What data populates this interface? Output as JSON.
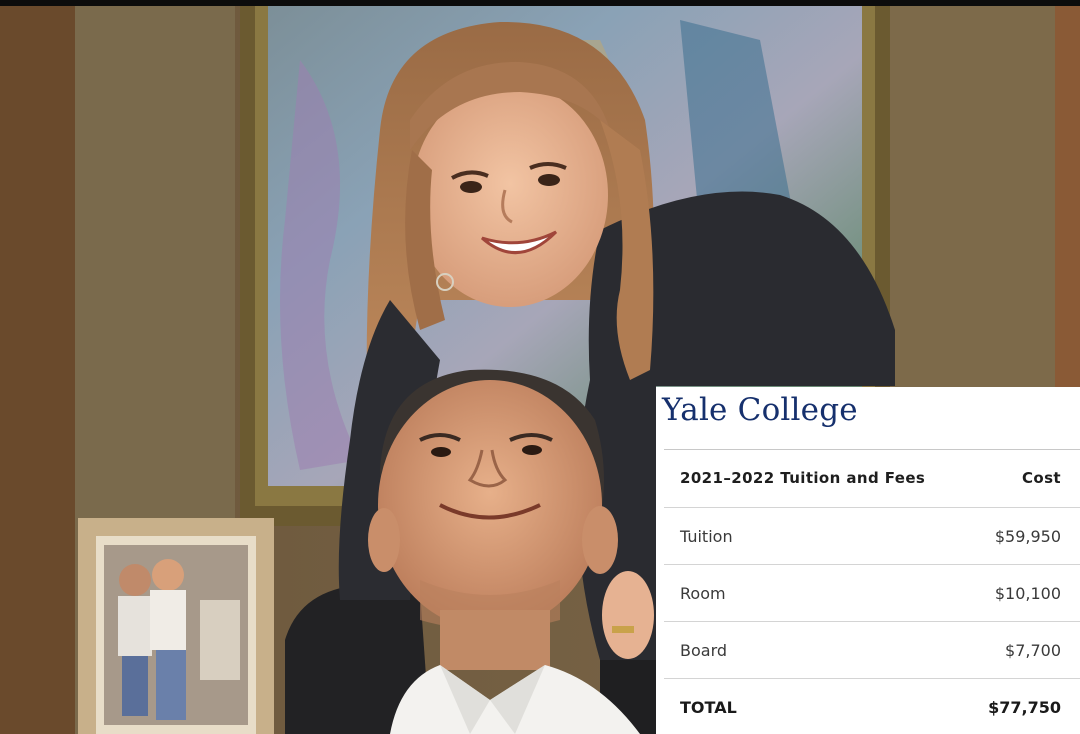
{
  "photo": {
    "description_icon": "photo-scene"
  },
  "card": {
    "title": "Yale College",
    "header": {
      "label": "2021–2022 Tuition and Fees",
      "cost": "Cost"
    },
    "rows": [
      {
        "label": "Tuition",
        "cost": "$59,950"
      },
      {
        "label": "Room",
        "cost": "$10,100"
      },
      {
        "label": "Board",
        "cost": "$7,700"
      }
    ],
    "total": {
      "label": "TOTAL",
      "cost": "$77,750"
    }
  },
  "colors": {
    "title": "#16306d",
    "card_bg": "#ffffff"
  }
}
